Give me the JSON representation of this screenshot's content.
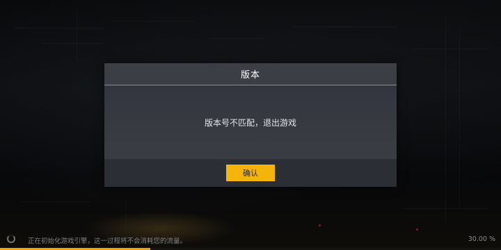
{
  "dialog": {
    "title": "版本",
    "message": "版本号不匹配，退出游戏",
    "confirm_label": "确认"
  },
  "loading": {
    "status_text": "正在初始化游戏引擎，这一过程将不会消耗您的流量。",
    "percent_text": "30.00 %",
    "progress_fraction": 0.3
  },
  "colors": {
    "accent": "#f5b40a",
    "dialog_bg": "#32353d",
    "progress": "#e8a80c"
  },
  "icons": {
    "spinner": "loading-spinner-icon"
  }
}
